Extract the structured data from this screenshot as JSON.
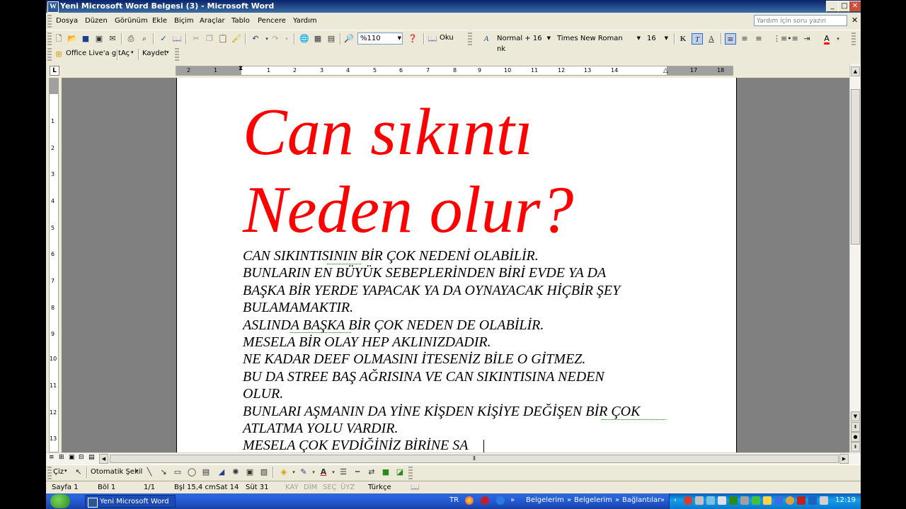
{
  "window": {
    "title": "Yeni Microsoft Word Belgesi (3) - Microsoft Word"
  },
  "menu": {
    "items": [
      "Dosya",
      "Düzen",
      "Görünüm",
      "Ekle",
      "Biçim",
      "Araçlar",
      "Tablo",
      "Pencere",
      "Yardım"
    ],
    "help_placeholder": "Yardım için soru yazın"
  },
  "toolbar": {
    "zoom": "%110",
    "read": "Oku",
    "style": "Normal + 16 nk",
    "font": "Times New Roman",
    "size": "16",
    "bold": "K",
    "italic": "T",
    "underline": "A"
  },
  "toolbar2": {
    "office_live": "Office Live'a git",
    "open": "Aç",
    "save": "Kaydet"
  },
  "ruler": {
    "h_ticks": [
      "2",
      "1",
      "1",
      "2",
      "3",
      "4",
      "5",
      "6",
      "7",
      "8",
      "9",
      "10",
      "11",
      "12",
      "13",
      "14",
      "15",
      "17",
      "18"
    ],
    "v_ticks": [
      "1",
      "2",
      "3",
      "4",
      "5",
      "6",
      "7",
      "8",
      "9",
      "10",
      "11",
      "12",
      "13"
    ]
  },
  "document": {
    "headings": [
      "Can sıkıntı",
      "Neden olur?"
    ],
    "lines": [
      "CAN SIKINTISININ BİR ÇOK NEDENİ OLABİLİR.",
      "BUNLARIN EN BÜYÜK SEBEPLERİNDEN BİRİ EVDE YA DA",
      "BAŞKA BİR YERDE YAPACAK YA DA OYNAYACAK HİÇBİR ŞEY",
      "BULAMAMAKTIR.",
      "ASLINDA BAŞKA BİR ÇOK NEDEN DE OLABİLİR.",
      "MESELA BİR OLAY HEP AKLINIZDADIR.",
      "NE KADAR DEEF OLMASINI İTESENİZ BİLE O GİTMEZ.",
      "BU DA STREE BAŞ AĞRISINA VE CAN SIKINTISINA NEDEN",
      "OLUR.",
      "BUNLARI AŞMANIN DA YİNE KİŞDEN KİŞİYE DEĞİŞEN BİR ÇOK",
      "ATLATMA YOLU VARDIR.",
      "MESELA ÇOK EVDİĞİNİZ BİRİNE SA"
    ]
  },
  "drawing": {
    "draw": "Çiz",
    "autoshapes": "Otomatik Şekil"
  },
  "status": {
    "page": "Sayfa  1",
    "section": "Böl  1",
    "pages": "1/1",
    "at": "Bşl  15,4 cm",
    "line": "Sat  14",
    "col": "Süt  31",
    "rec": "KAY",
    "trk": "DİM",
    "ext": "SEÇ",
    "ovr": "ÜYZ",
    "lang": "Türkçe"
  },
  "taskbar": {
    "task": "Yeni Microsoft Word ...",
    "lang": "TR",
    "links": [
      "Belgelerim",
      "Belgelerim",
      "Bağlantılar"
    ],
    "clock": "12:19"
  }
}
